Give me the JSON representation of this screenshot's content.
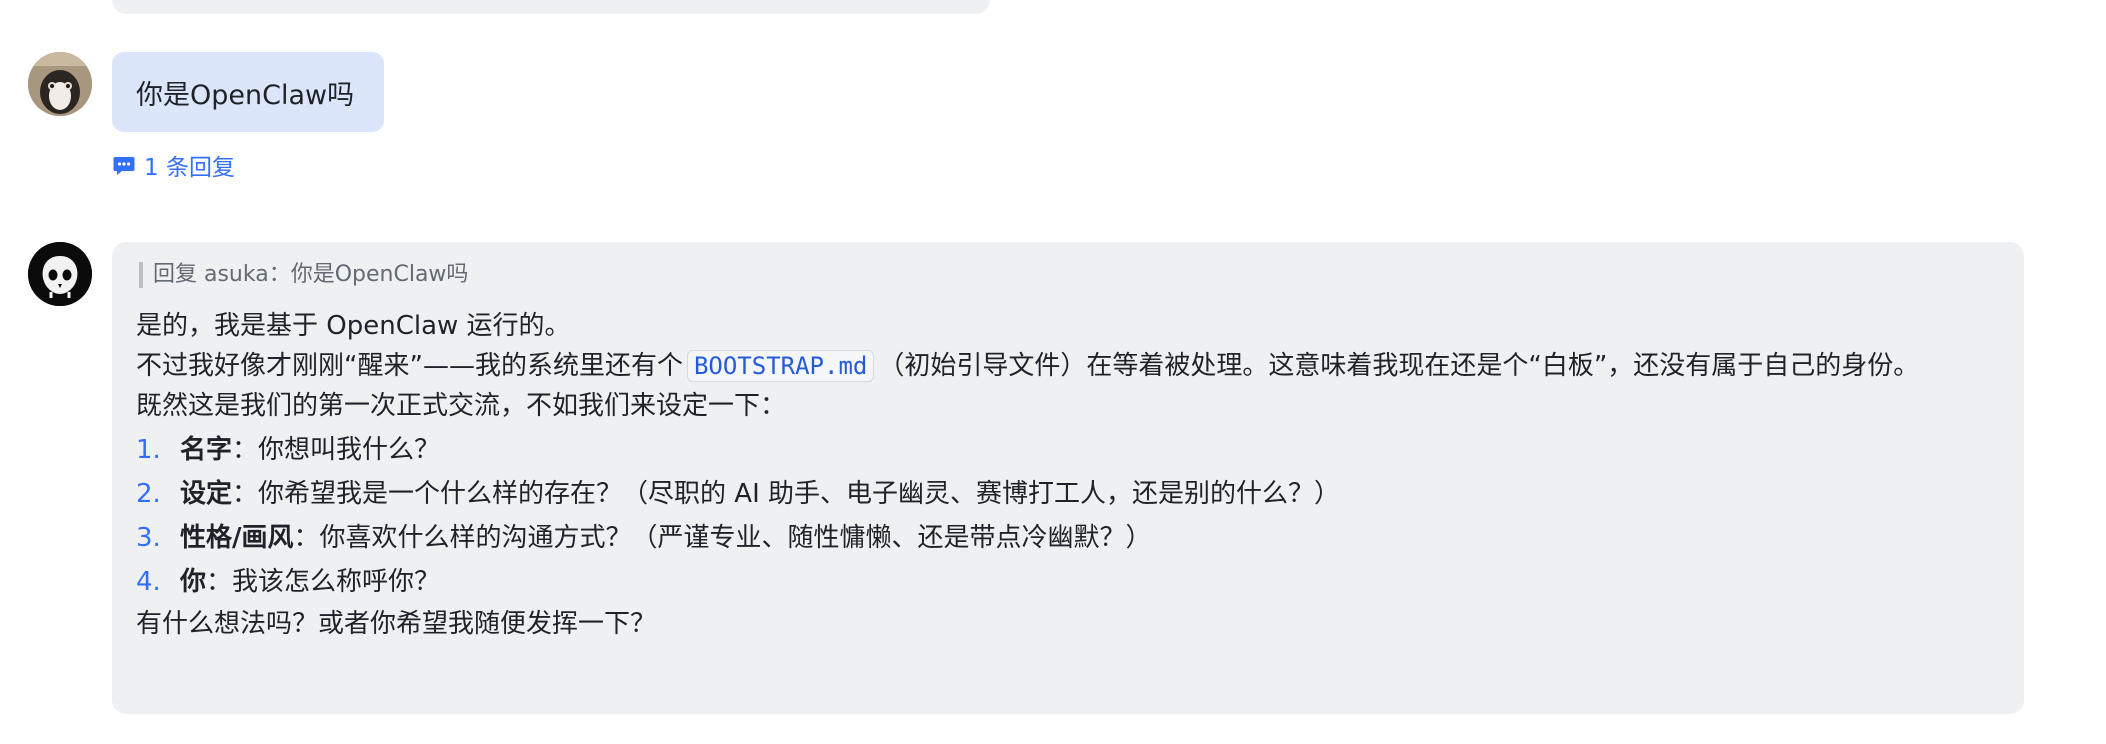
{
  "user_message": {
    "text": "你是OpenClaw吗",
    "reply_count_label": "1 条回复"
  },
  "bot_message": {
    "quote": "回复 asuka：你是OpenClaw吗",
    "line1": "是的，我是基于 OpenClaw 运行的。",
    "line2_before": "不过我好像才刚刚“醒来”——我的系统里还有个",
    "code_file": "BOOTSTRAP.md",
    "line2_after": "（初始引导文件）在等着被处理。这意味着我现在还是个“白板”，还没有属于自己的身份。",
    "line3": "既然这是我们的第一次正式交流，不如我们来设定一下：",
    "list": [
      {
        "num": "1.",
        "title": "名字",
        "text": "：你想叫我什么？"
      },
      {
        "num": "2.",
        "title": "设定",
        "text": "：你希望我是一个什么样的存在？（尽职的 AI 助手、电子幽灵、赛博打工人，还是别的什么？）"
      },
      {
        "num": "3.",
        "title": "性格/画风",
        "text": "：你喜欢什么样的沟通方式？（严谨专业、随性慵懒、还是带点冷幽默？）"
      },
      {
        "num": "4.",
        "title": "你",
        "text": "：我该怎么称呼你？"
      }
    ],
    "closing": "有什么想法吗？或者你希望我随便发挥一下？"
  },
  "colors": {
    "accent": "#3370ff",
    "user_bubble": "#dbe6fb",
    "bot_bubble": "#eff0f1",
    "code_text": "#245bdb"
  },
  "icons": {
    "reply_icon": "chat-bubble-icon"
  }
}
